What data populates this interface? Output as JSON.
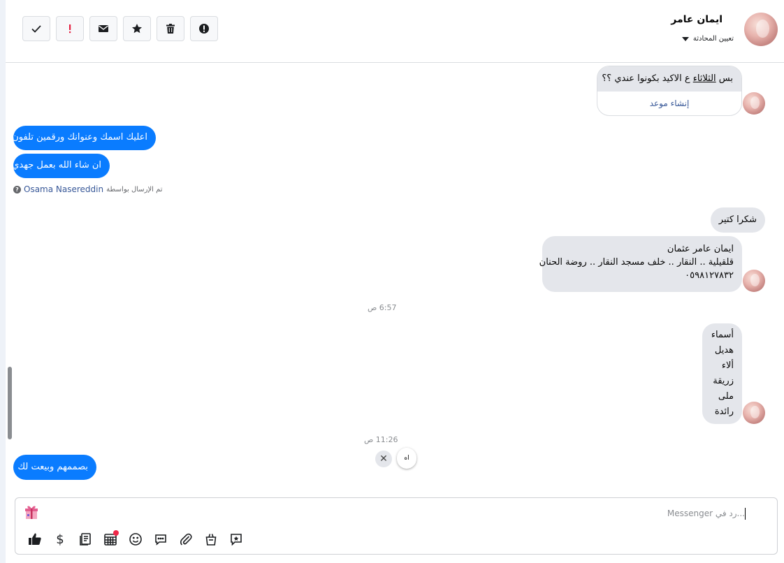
{
  "toolbar": {
    "buttons": [
      {
        "name": "mark-done-button",
        "icon": "check-icon"
      },
      {
        "name": "mark-follow-up-button",
        "icon": "exclamation-icon",
        "color": "#e41e3f"
      },
      {
        "name": "mark-unread-button",
        "icon": "envelope-icon"
      },
      {
        "name": "star-button",
        "icon": "star-icon"
      },
      {
        "name": "delete-button",
        "icon": "trash-icon"
      },
      {
        "name": "spam-button",
        "icon": "alert-circle-icon"
      }
    ]
  },
  "contact": {
    "name": "ايمان عامر",
    "assign_label": "تعيين المحادثة"
  },
  "messages": {
    "m1_pre": "بس ",
    "m1_ul": "الثلاثاء",
    "m1_post": " ع الاكيد بكونوا عندي ؟؟",
    "m1_action": "إنشاء موعد",
    "m2": "اعليك اسمك وعنوانك ورقمين تلفون",
    "m3": "ان شاء الله بعمل جهدي",
    "sent_by_prefix": "تم الإرسال بواسطة",
    "sent_by_name": "Osama Nasereddin",
    "m4": "شكرا كتير",
    "m5": [
      "ايمان عامر عثمان",
      "قلقيلية .. النقار .. خلف مسجد النقار .. روضة الحنان",
      "٠٥٩٨١٢٧٨٣٢"
    ],
    "ts1": "6:57 ص",
    "m6": [
      "أسماء",
      "هديل",
      "ألاء",
      "زريقة",
      "ملى",
      "رائدة"
    ],
    "ts2": "11:26 ص",
    "quick_reply": "اه",
    "m7": "بصممهم وبيعت لك"
  },
  "composer": {
    "placeholder": "...رد في Messenger",
    "tools": [
      {
        "name": "like-button",
        "icon": "thumbs-up-icon"
      },
      {
        "name": "payment-button",
        "icon": "dollar-icon",
        "glyph": "$"
      },
      {
        "name": "saved-replies-button",
        "icon": "notes-icon"
      },
      {
        "name": "appointment-button",
        "icon": "calendar-icon",
        "badge_color": "#f02849"
      },
      {
        "name": "emoji-button",
        "icon": "smiley-icon"
      },
      {
        "name": "message-button",
        "icon": "chat-bubble-icon"
      },
      {
        "name": "attach-button",
        "icon": "paperclip-icon"
      },
      {
        "name": "shop-button",
        "icon": "shopping-bag-icon"
      },
      {
        "name": "feedback-button",
        "icon": "chat-star-icon"
      }
    ]
  },
  "colors": {
    "outgoing": "#0a7cff",
    "incoming": "#e4e6eb",
    "link": "#385898"
  }
}
